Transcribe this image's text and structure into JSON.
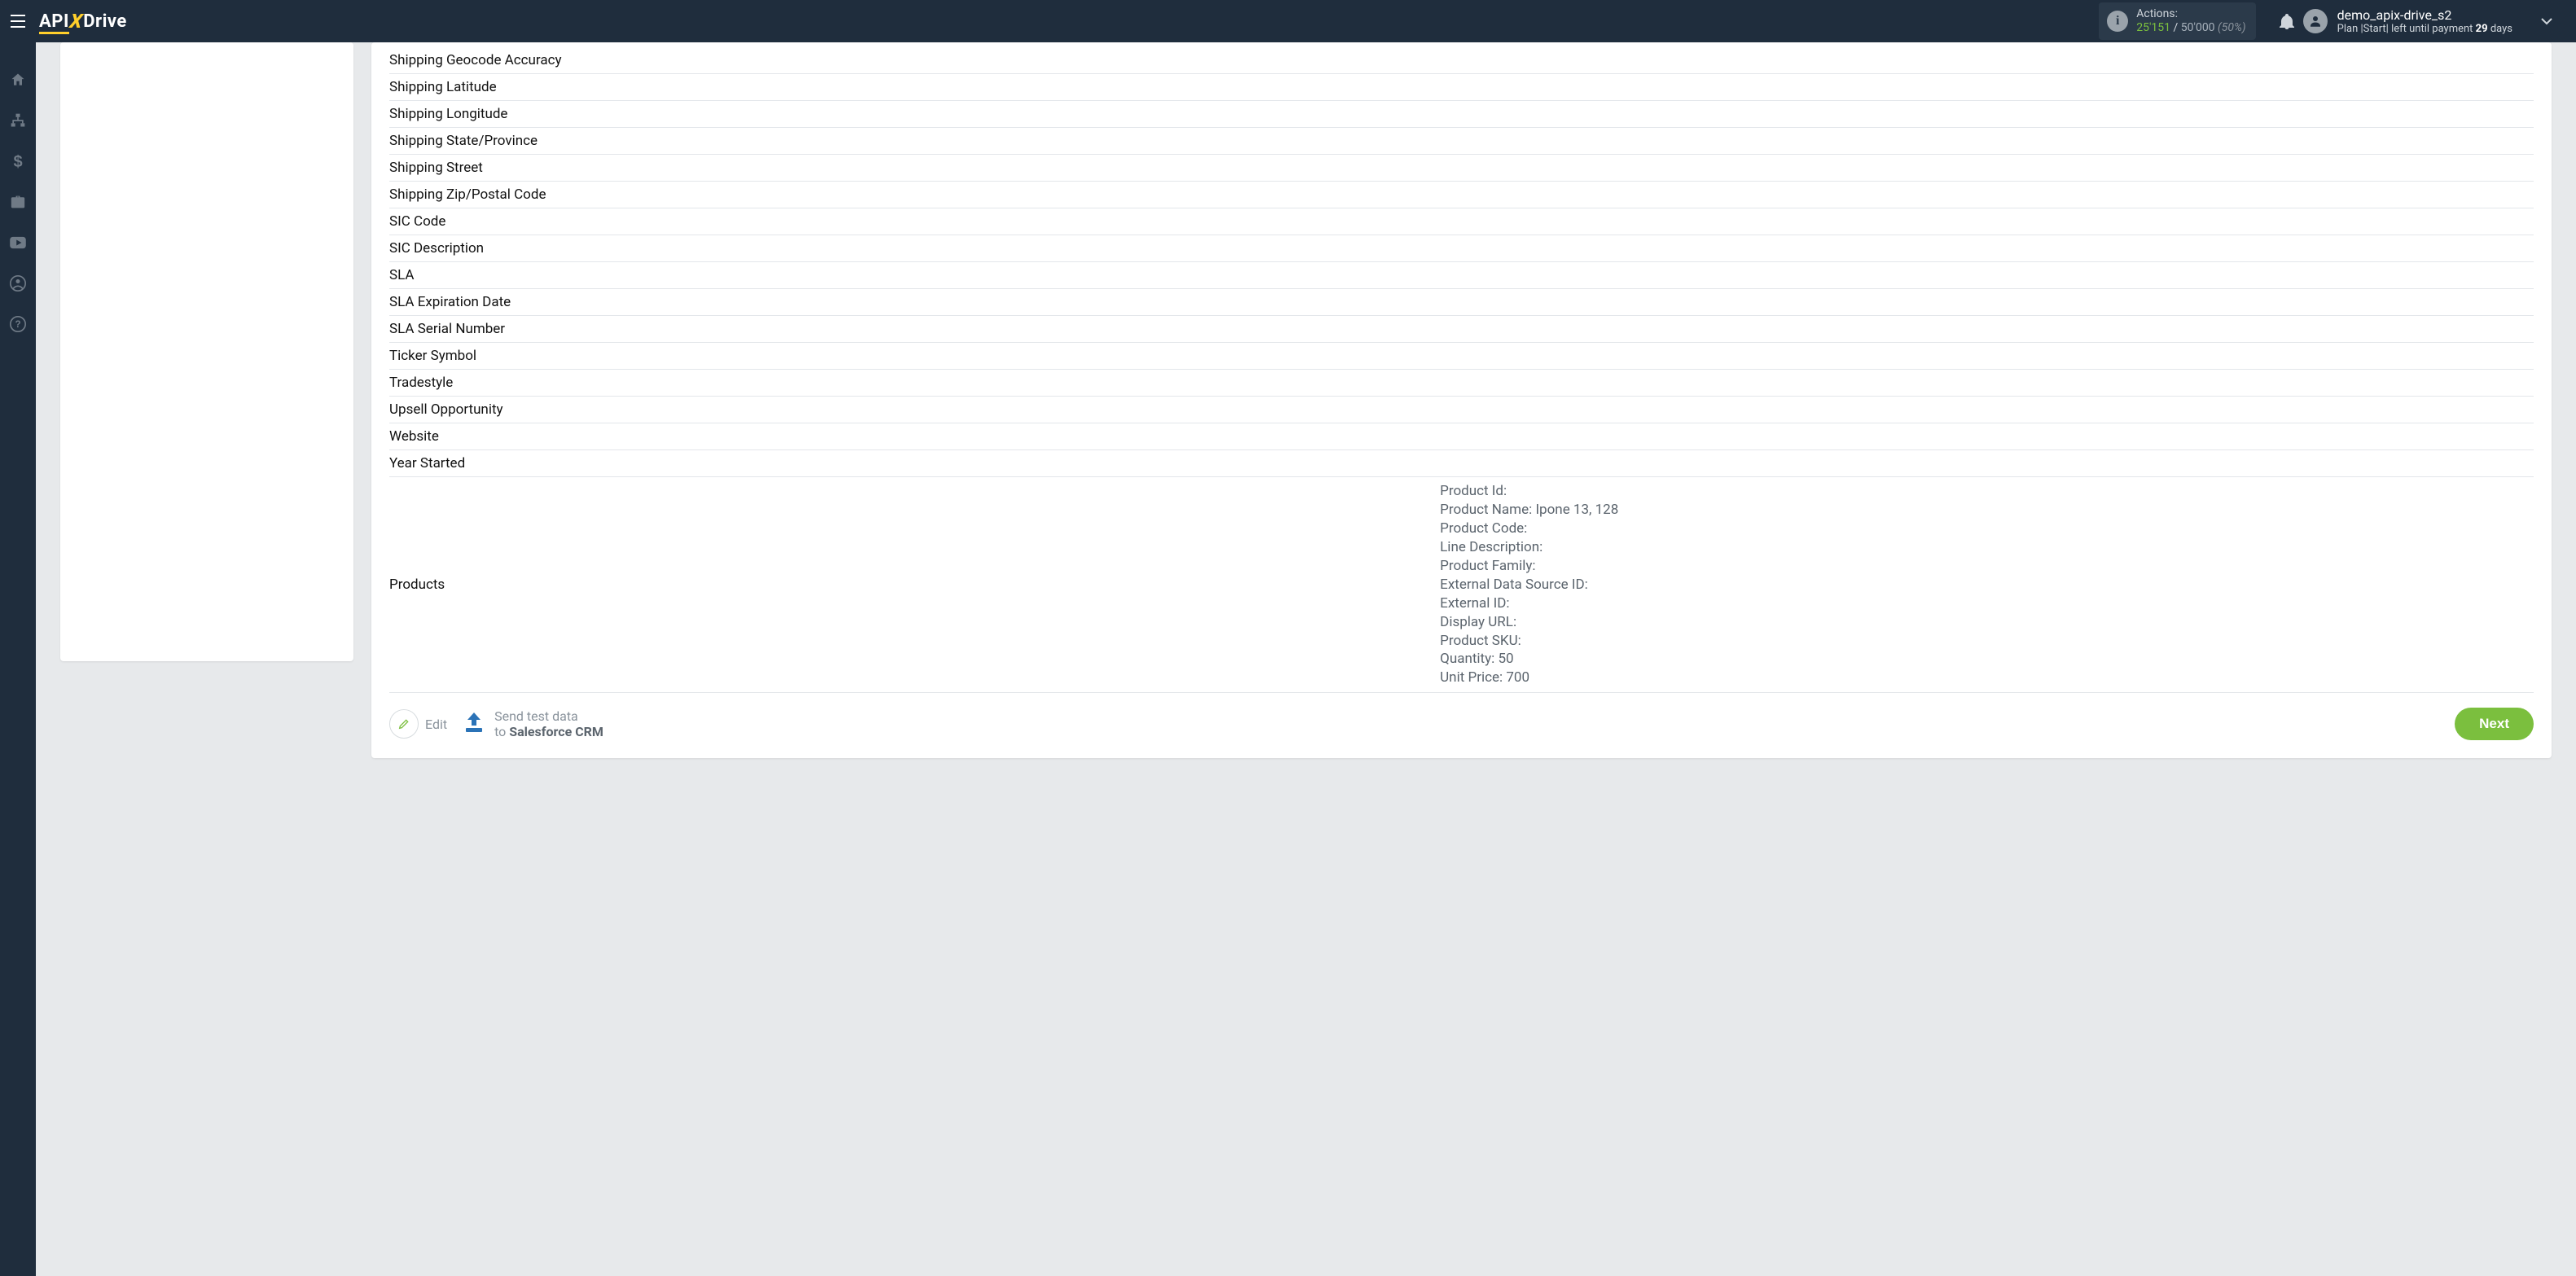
{
  "header": {
    "logo_api": "API",
    "logo_x": "X",
    "logo_drive": "Drive",
    "actions_label": "Actions:",
    "actions_used": "25'151",
    "actions_sep": " / ",
    "actions_limit": "50'000",
    "actions_pct": "(50%)",
    "user_name": "demo_apix-drive_s2",
    "plan_prefix": "Plan ",
    "plan_name": "|Start|",
    "plan_middle": " left until payment ",
    "plan_days": "29",
    "plan_days_suffix": " days"
  },
  "fields": [
    "Shipping Geocode Accuracy",
    "Shipping Latitude",
    "Shipping Longitude",
    "Shipping State/Province",
    "Shipping Street",
    "Shipping Zip/Postal Code",
    "SIC Code",
    "SIC Description",
    "SLA",
    "SLA Expiration Date",
    "SLA Serial Number",
    "Ticker Symbol",
    "Tradestyle",
    "Upsell Opportunity",
    "Website",
    "Year Started"
  ],
  "products_label": "Products",
  "product_lines": [
    "Product Id:",
    "Product Name: Ipone 13, 128",
    "Product Code:",
    "Line Description:",
    "Product Family:",
    "External Data Source ID:",
    "External ID:",
    "Display URL:",
    "Product SKU:",
    "Quantity: 50",
    "Unit Price: 700"
  ],
  "footer": {
    "edit": "Edit",
    "send_line1": "Send test data",
    "send_line2_prefix": "to ",
    "send_line2_target": "Salesforce CRM",
    "next": "Next"
  }
}
